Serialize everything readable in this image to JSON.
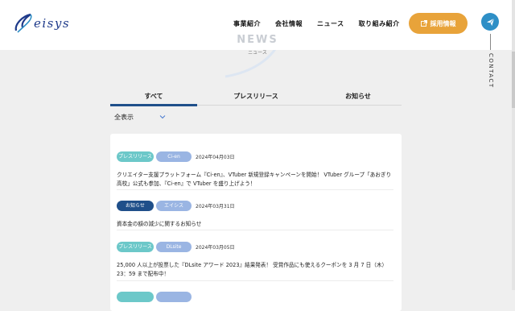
{
  "brand": {
    "logo_text": "eisys",
    "logo_letter": "S",
    "accent": "#1e3a8a"
  },
  "nav": {
    "items": [
      "事業紹介",
      "会社情報",
      "ニュース",
      "取り組み紹介"
    ],
    "recruit_label": "採用情報",
    "recruit_color": "#e8a33a",
    "contact_label": "CONTACT",
    "contact_icon": "paper-plane-icon"
  },
  "hero": {
    "title": "NEWS",
    "subtitle": "ニュース"
  },
  "tabs": {
    "items": [
      "すべて",
      "プレスリリース",
      "お知らせ"
    ],
    "active": "すべて",
    "active_color": "#1f4f8a"
  },
  "filter": {
    "label": "全表示"
  },
  "news": [
    {
      "tags": [
        "プレスリリース",
        "Ci-en"
      ],
      "date": "2024年04月03日",
      "title": "クリエイター支援プラットフォーム『Ci-en』、VTuber 新規登録キャンペーンを開始！ VTuber グループ「あおぎり高校」公式も参加、『Ci-en』で VTuber を盛り上げよう！"
    },
    {
      "tags": [
        "お知らせ",
        "エイシス"
      ],
      "date": "2024年03月31日",
      "title": "資本金の額の減少に関するお知らせ"
    },
    {
      "tags": [
        "プレスリリース",
        "DLsite"
      ],
      "date": "2024年03月05日",
      "title": "25,000 人以上が投票した『DLsite アワード 2023』結果発表！ 受賞作品にも使えるクーポンを 3 月 7 日（木）23：59 まで配布中！"
    }
  ]
}
